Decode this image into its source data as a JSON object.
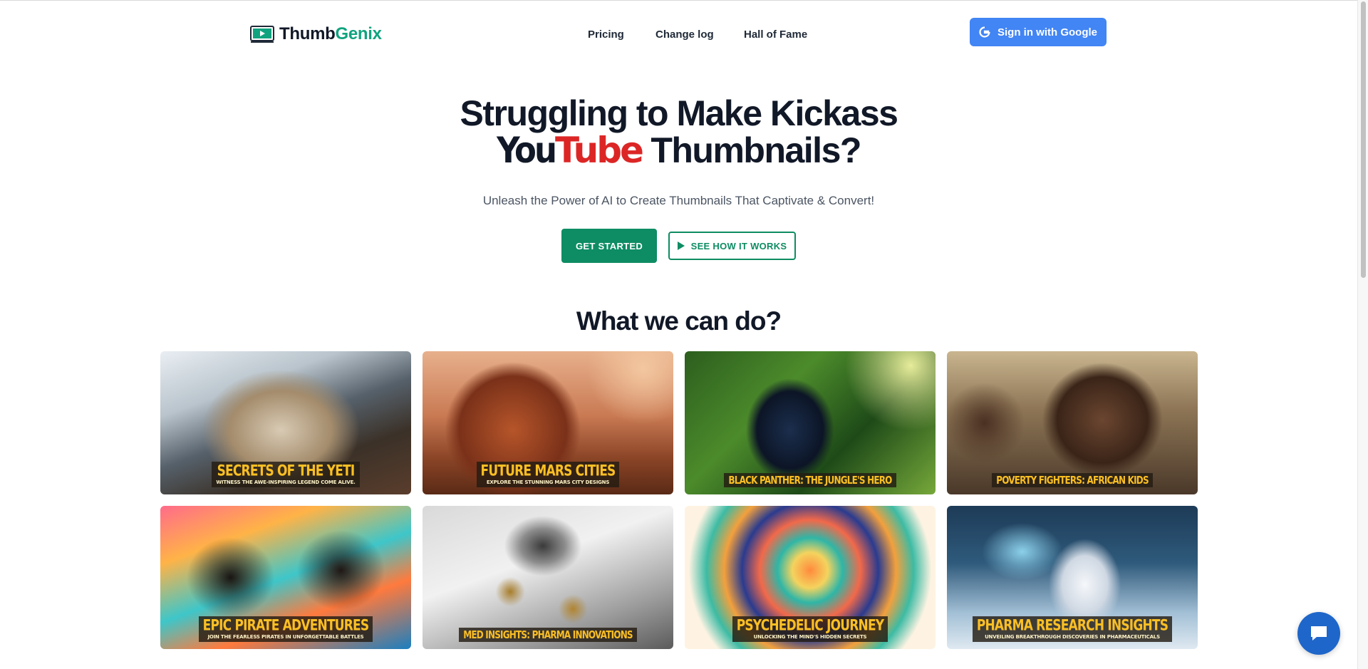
{
  "brand": {
    "name_part1": "Thumb",
    "name_part2": "Genix"
  },
  "nav": {
    "pricing": "Pricing",
    "changelog": "Change log",
    "hall_of_fame": "Hall of Fame"
  },
  "auth": {
    "signin_label": "Sign in with Google"
  },
  "hero": {
    "title_line1": "Struggling to Make Kickass",
    "title_you": "You",
    "title_tube": "Tube",
    "title_rest": " Thumbnails?",
    "subtitle": "Unleash the Power of AI to Create Thumbnails That Captivate & Convert!",
    "cta_primary": "GET STARTED",
    "cta_secondary": "SEE HOW IT WORKS"
  },
  "section": {
    "title": "What we can do?"
  },
  "gallery": [
    {
      "title": "Secrets of the Yeti",
      "subtitle": "Witness the awe-inspiring legend come alive."
    },
    {
      "title": "Future Mars Cities",
      "subtitle": "Explore the stunning Mars city designs"
    },
    {
      "title": "Black Panther: The Jungle's Hero",
      "subtitle": ""
    },
    {
      "title": "Poverty Fighters: African Kids",
      "subtitle": ""
    },
    {
      "title": "Epic Pirate Adventures",
      "subtitle": "Join the fearless pirates in unforgettable battles"
    },
    {
      "title": "Med Insights: Pharma Innovations",
      "subtitle": ""
    },
    {
      "title": "Psychedelic Journey",
      "subtitle": "Unlocking the mind's hidden secrets"
    },
    {
      "title": "Pharma Research Insights",
      "subtitle": "Unveiling breakthrough discoveries in pharmaceuticals"
    }
  ],
  "colors": {
    "accent": "#0e8c63",
    "brand_green": "#10a37f",
    "google_blue": "#4285f4",
    "youtube_red": "#dc2626",
    "chat_blue": "#1e66c9"
  },
  "icons": {
    "logo": "video-thumbnail-icon",
    "google": "google-g-icon",
    "play": "play-icon",
    "chat": "chat-bubble-icon"
  }
}
